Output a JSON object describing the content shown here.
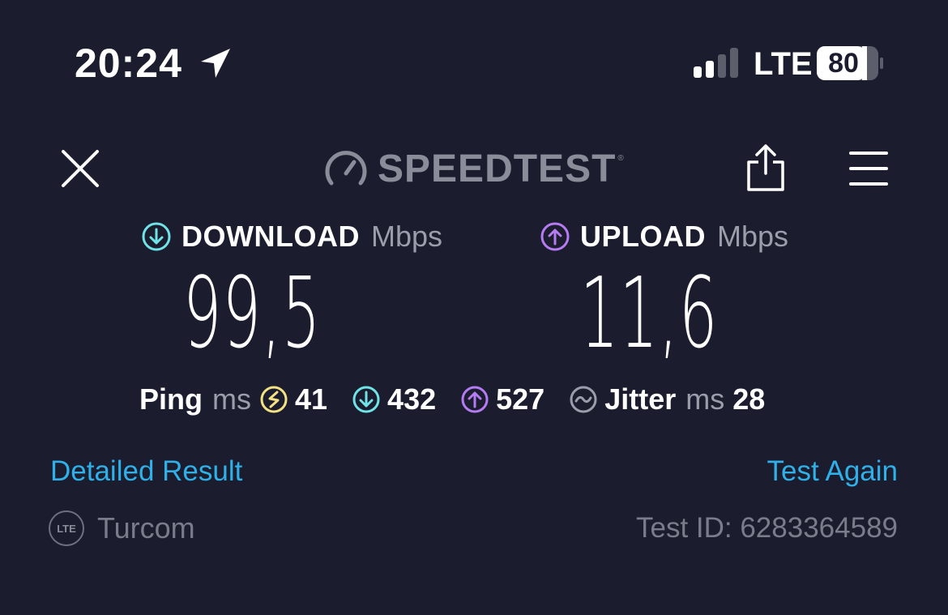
{
  "status_bar": {
    "time": "20:24",
    "location_icon": "location-arrow-icon",
    "signal_icon": "cellular-signal-icon",
    "network": "LTE",
    "battery_level": "80"
  },
  "toolbar": {
    "close_icon": "close-icon",
    "logo_text": "SPEEDTEST",
    "logo_tm": "®",
    "share_icon": "share-icon",
    "menu_icon": "menu-icon"
  },
  "download": {
    "label": "DOWNLOAD",
    "unit": "Mbps",
    "value": "99,5",
    "color": "#6fe3e6"
  },
  "upload": {
    "label": "UPLOAD",
    "unit": "Mbps",
    "value": "11,6",
    "color": "#b57bf3"
  },
  "ping": {
    "label": "Ping",
    "unit": "ms",
    "idle": "41",
    "idle_color": "#f2e283",
    "download": "432",
    "upload": "527",
    "jitter_label": "Jitter",
    "jitter_unit": "ms",
    "jitter": "28"
  },
  "links": {
    "detailed": "Detailed Result",
    "again": "Test Again",
    "color": "#2fb0e8"
  },
  "footer": {
    "network_badge": "LTE",
    "provider": "Turcom",
    "test_id": "Test ID: 6283364589"
  }
}
